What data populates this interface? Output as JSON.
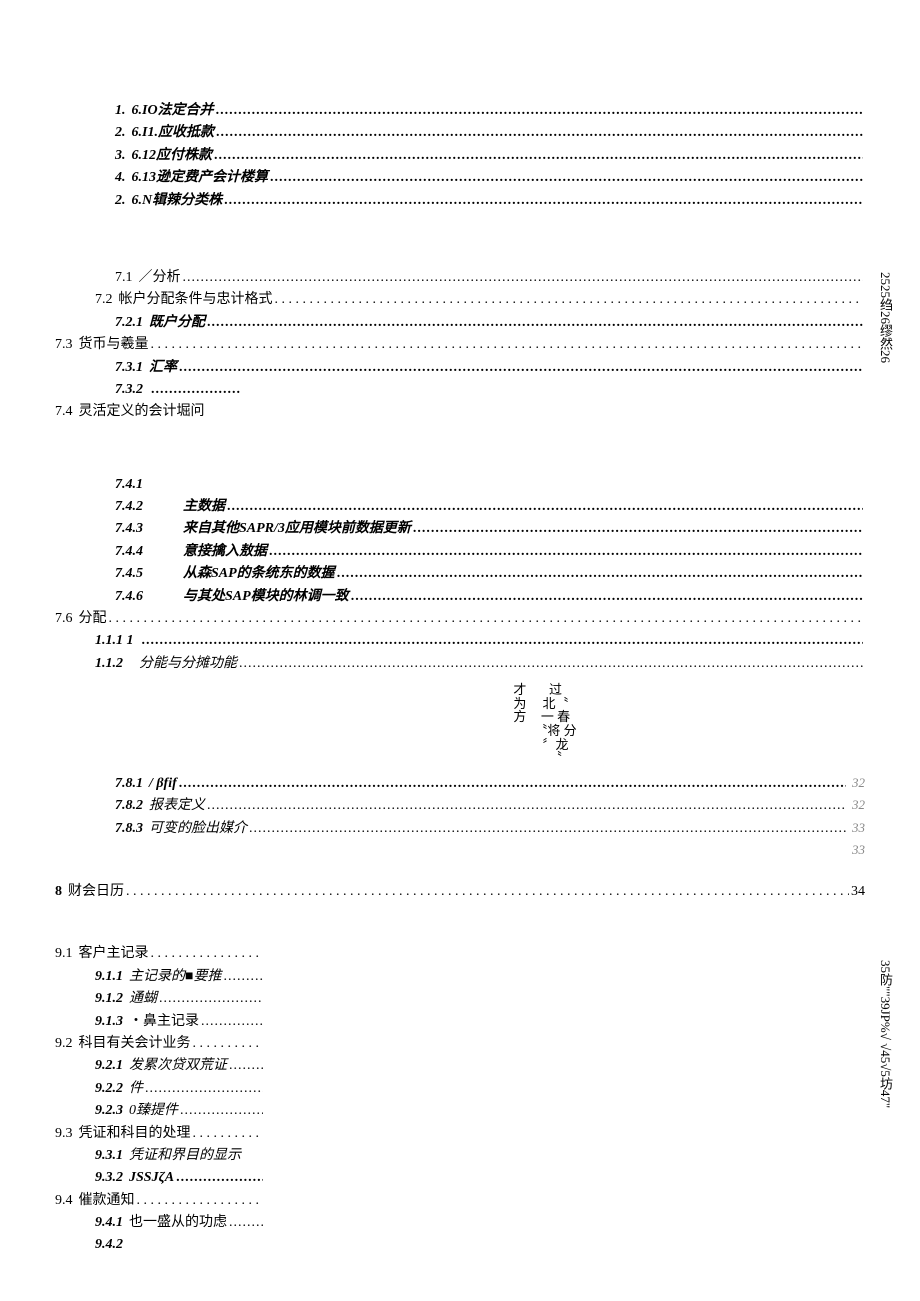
{
  "group6": [
    {
      "num": "1.",
      "label": "6.IO法定合并"
    },
    {
      "num": "2.",
      "label": "6.I1.应收抵款"
    },
    {
      "num": "3.",
      "label": "6.12应付株款"
    },
    {
      "num": "4.",
      "label": "6.13逊定费产会计楼算"
    },
    {
      "num": "2.",
      "label": "6.N辑辣分类株"
    }
  ],
  "group7a": [
    {
      "indent": "indent2",
      "num": "7.1",
      "label": "／分析",
      "leader": "dense"
    },
    {
      "indent": "indent1",
      "num": "7.2",
      "label": "帐户分配条件与忠计格式",
      "leader": "sparse"
    },
    {
      "indent": "indent2",
      "num": "7.2.1",
      "label": "既户分配",
      "bi": true,
      "leader": "dense"
    },
    {
      "indent": "",
      "num": "7.3",
      "label": "货币与羲量",
      "leader": "sparse"
    },
    {
      "indent": "indent2",
      "num": "7.3.1",
      "label": "汇率",
      "bi": true,
      "leader": "dense"
    },
    {
      "indent": "indent2",
      "num": "7.3.2",
      "label": "",
      "bi": true,
      "leader": "short"
    },
    {
      "indent": "",
      "num": "7.4",
      "label": "灵活定义的会计堀问",
      "leader": "none"
    }
  ],
  "vside1": "2525绉26缪然26",
  "group7b": [
    {
      "num": "7.4.1",
      "label": "",
      "bi": true
    },
    {
      "num": "7.4.2",
      "label": "主数据",
      "it": true,
      "leader": "dense"
    },
    {
      "num": "7.4.3",
      "label": "来自其他SAPR/3应用模块前数据更新",
      "it": true,
      "leader": "dense"
    },
    {
      "num": "7.4.4",
      "label": "意接擒入敖据",
      "it": true,
      "leader": "dense"
    },
    {
      "num": "7.4.5",
      "label": "从森SAP的条统东的数握",
      "it": true,
      "leader": "dense"
    },
    {
      "num": "7.4.6",
      "label": "与其处SAP模块的林调一致",
      "it": true,
      "leader": "dense"
    }
  ],
  "sec76": {
    "num": "7.6",
    "label": "分配",
    "leader": "sparse"
  },
  "sec111": {
    "num": "1.1.1  1",
    "label": "",
    "bi": true,
    "leader": "dense"
  },
  "sec112": {
    "num": "1.1.2",
    "label": "分能与分摊功能",
    "it": true,
    "leader": "dense"
  },
  "glyphs_left": [
    "才",
    "为",
    "方"
  ],
  "glyphs_right": [
    "过",
    "北〝",
    "一 春",
    "〝将 分",
    "〞龙",
    "〝"
  ],
  "group78": [
    {
      "num": "7.8.1",
      "label": "/ βfif",
      "bi": true,
      "leader": "dense",
      "page": "32"
    },
    {
      "num": "7.8.2",
      "label": "报表定义",
      "it": true,
      "leader": "dense",
      "page": "32"
    },
    {
      "num": "7.8.3",
      "label": "可变的脸出媒介",
      "it": true,
      "leader": "dense",
      "page": "33"
    }
  ],
  "trail33": "33",
  "sec8": {
    "num": "8",
    "label": "财会日历",
    "leader": "sparse",
    "page": "34"
  },
  "group9": [
    {
      "indent": "",
      "num": "9.1",
      "label": "客户主记录",
      "leader": "sparse"
    },
    {
      "indent": "indent1",
      "num": "9.1.1",
      "label": "主记录的■要推",
      "bi_num": true,
      "it": true,
      "leader": "dense"
    },
    {
      "indent": "indent1",
      "num": "9.1.2",
      "label": "通蝴",
      "bi_num": true,
      "it": true,
      "leader": "dense"
    },
    {
      "indent": "indent1",
      "num": "9.1.3",
      "label": "・鼻主记录",
      "bi_num": true,
      "leader": "dense"
    },
    {
      "indent": "",
      "num": "9.2",
      "label": "科目有关会计业务",
      "leader": "sparse"
    },
    {
      "indent": "indent1",
      "num": "9.2.1",
      "label": "发累次贷双荒证",
      "bi_num": true,
      "it": true,
      "leader": "dense"
    },
    {
      "indent": "indent1",
      "num": "9.2.2",
      "label": "     件",
      "bi_num": true,
      "it": true,
      "leader": "dense"
    },
    {
      "indent": "indent1",
      "num": "9.2.3",
      "label": "0臻提件",
      "bi_num": true,
      "it": true,
      "leader": "dense"
    },
    {
      "indent": "",
      "num": "9.3",
      "label": "凭证和科目的处理",
      "leader": "sparse"
    },
    {
      "indent": "indent1",
      "num": "9.3.1",
      "label": "凭证和界目的显示",
      "bi_num": true,
      "it": true,
      "leader": "none"
    },
    {
      "indent": "indent1",
      "num": "9.3.2",
      "label": "JSSJζA",
      "bi_num": true,
      "bi": true,
      "leader": "dense"
    },
    {
      "indent": "",
      "num": "9.4",
      "label": "催款通知",
      "leader": "sparse"
    },
    {
      "indent": "indent1",
      "num": "9.4.1",
      "label": "也一盛从的功虑",
      "bi_num": true,
      "leader": "dense"
    },
    {
      "indent": "indent1",
      "num": "9.4.2",
      "label": "",
      "bi_num": true,
      "leader": "none"
    }
  ],
  "vside2": "35防\"\"39JP%√ √45√5坊47\""
}
